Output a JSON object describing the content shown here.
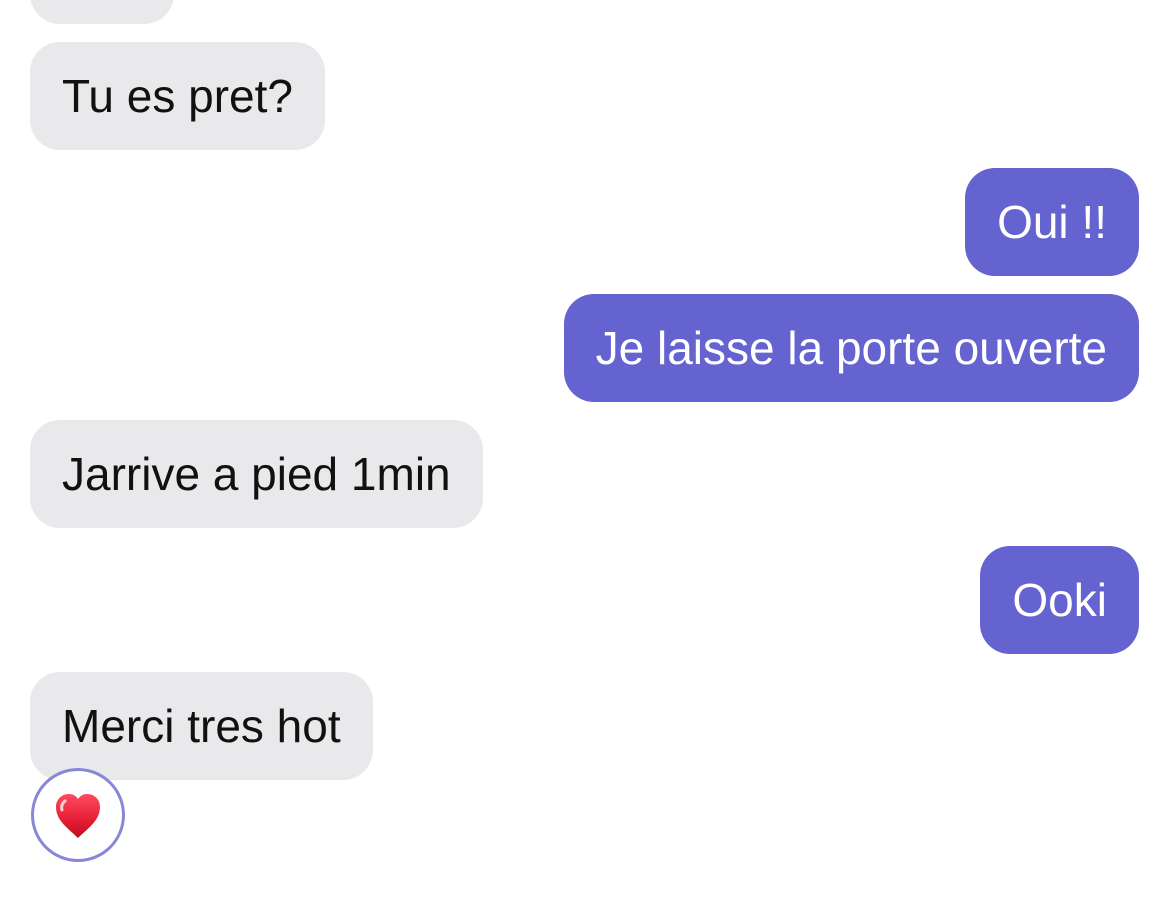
{
  "conversation": {
    "messages": [
      {
        "direction": "incoming",
        "text": ""
      },
      {
        "direction": "incoming",
        "text": "Tu es pret?"
      },
      {
        "direction": "outgoing",
        "text": "Oui !!"
      },
      {
        "direction": "outgoing",
        "text": "Je laisse la porte ouverte"
      },
      {
        "direction": "incoming",
        "text": "Jarrive a pied 1min"
      },
      {
        "direction": "outgoing",
        "text": "Ooki"
      },
      {
        "direction": "incoming",
        "text": "Merci tres hot",
        "reaction": "heart-icon"
      }
    ]
  },
  "colors": {
    "incoming_bubble": "#e9e9eb",
    "outgoing_bubble": "#6563cf",
    "incoming_text": "#111111",
    "outgoing_text": "#ffffff",
    "reaction_border": "#8a86d6",
    "heart": "#d9162b"
  }
}
